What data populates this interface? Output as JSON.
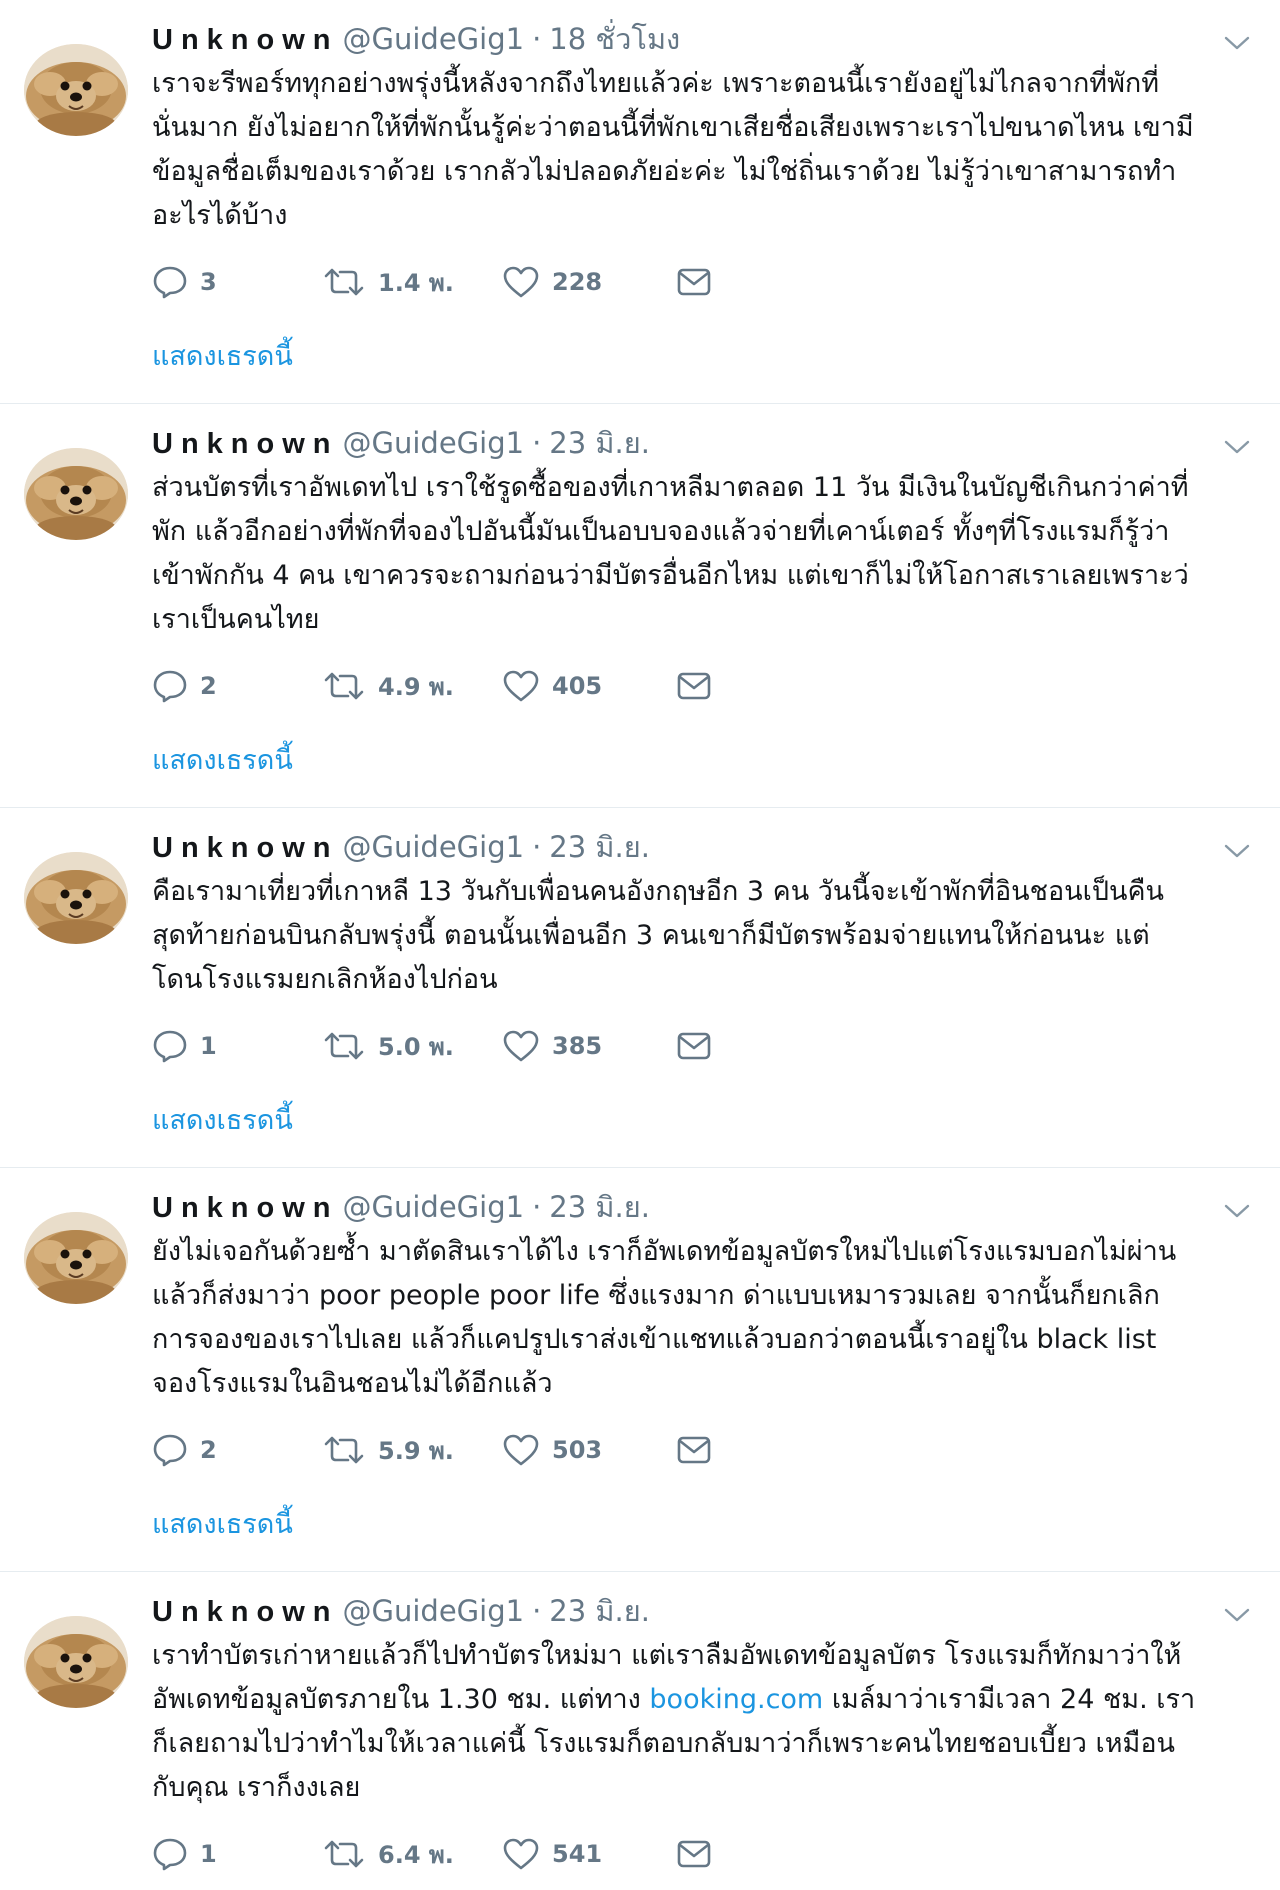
{
  "tweets": [
    {
      "name": "Unknown",
      "handle": "@GuideGig1",
      "time": "18 ชั่วโมง",
      "text": "เราจะรีพอร์ททุกอย่างพรุ่งนี้หลังจากถึงไทยแล้วค่ะ เพราะตอนนี้เรายังอยู่ไม่ไกลจากที่พักที่\nนั่นมาก ยังไม่อยากให้ที่พักนั้นรู้ค่ะว่าตอนนี้ที่พักเขาเสียชื่อเสียงเพราะเราไปขนาดไหน เขามี\nข้อมูลชื่อเต็มของเราด้วย เรากลัวไม่ปลอดภัยอ่ะค่ะ ไม่ใช่ถิ่นเราด้วย ไม่รู้ว่าเขาสามารถทำ\nอะไรได้บ้าง",
      "replies": "3",
      "retweets": "1.4 พ.",
      "likes": "228",
      "thread_label": "แสดงเธรดนี้"
    },
    {
      "name": "Unknown",
      "handle": "@GuideGig1",
      "time": "23 มิ.ย.",
      "text": "ส่วนบัตรที่เราอัพเดทไป เราใช้รูดซื้อของที่เกาหลีมาตลอด 11 วัน มีเงินในบัญชีเกินกว่าค่าที่\nพัก แล้วอีกอย่างที่พักที่จองไปอันนี้มันเป็นอบบจองแล้วจ่ายที่เคาน์เตอร์ ทั้งๆที่โรงแรมก็รู้ว่า\nเข้าพักกัน 4 คน เขาควรจะถามก่อนว่ามีบัตรอื่นอีกไหม แต่เขาก็ไม่ให้โอกาสเราเลยเพราะว่\nเราเป็นคนไทย",
      "replies": "2",
      "retweets": "4.9 พ.",
      "likes": "405",
      "thread_label": "แสดงเธรดนี้"
    },
    {
      "name": "Unknown",
      "handle": "@GuideGig1",
      "time": "23 มิ.ย.",
      "text": "คือเรามาเที่ยวที่เกาหลี 13 วันกับเพื่อนคนอังกฤษอีก 3 คน วันนี้จะเข้าพักที่อินชอนเป็นคืน\nสุดท้ายก่อนบินกลับพรุ่งนี้ ตอนนั้นเพื่อนอีก 3 คนเขาก็มีบัตรพร้อมจ่ายแทนให้ก่อนนะ แต่\nโดนโรงแรมยกเลิกห้องไปก่อน",
      "replies": "1",
      "retweets": "5.0 พ.",
      "likes": "385",
      "thread_label": "แสดงเธรดนี้"
    },
    {
      "name": "Unknown",
      "handle": "@GuideGig1",
      "time": "23 มิ.ย.",
      "text": "ยังไม่เจอกันด้วยซ้ำ มาตัดสินเราได้ไง เราก็อัพเดทข้อมูลบัตรใหม่ไปแต่โรงแรมบอกไม่ผ่าน\nแล้วก็ส่งมาว่า poor people poor life ซึ่งแรงมาก ด่าแบบเหมารวมเลย จากนั้นก็ยกเลิก\nการจองของเราไปเลย แล้วก็แคปรูปเราส่งเข้าแชทแล้วบอกว่าตอนนี้เราอยู่ใน black list\nจองโรงแรมในอินชอนไม่ได้อีกแล้ว",
      "replies": "2",
      "retweets": "5.9 พ.",
      "likes": "503",
      "thread_label": "แสดงเธรดนี้"
    },
    {
      "name": "Unknown",
      "handle": "@GuideGig1",
      "time": "23 มิ.ย.",
      "text_before": "เราทำบัตรเก่าหายแล้วก็ไปทำบัตรใหม่มา แต่เราลืมอัพเดทข้อมูลบัตร โรงแรมก็ทักมาว่าให้\nอัพเดทข้อมูลบัตรภายใน 1.30 ชม. แต่ทาง ",
      "link": "booking.com",
      "text_after": " เมล์มาว่าเรามีเวลา 24 ชม. เรา\nก็เลยถามไปว่าทำไมให้เวลาแค่นี้ โรงแรมก็ตอบกลับมาว่าก็เพราะคนไทยชอบเบี้ยว เหมือน\nกับคุณ เราก็งงเลย",
      "replies": "1",
      "retweets": "6.4 พ.",
      "likes": "541"
    }
  ],
  "icons": {
    "avatar": "pomeranian-avatar",
    "menu": "chevron-down-icon",
    "reply": "reply-icon",
    "retweet": "retweet-icon",
    "like": "heart-icon",
    "dm": "envelope-icon"
  },
  "colors": {
    "text": "#14171a",
    "secondary": "#657786",
    "link": "#1b95e0",
    "divider": "#e6ecf0"
  }
}
